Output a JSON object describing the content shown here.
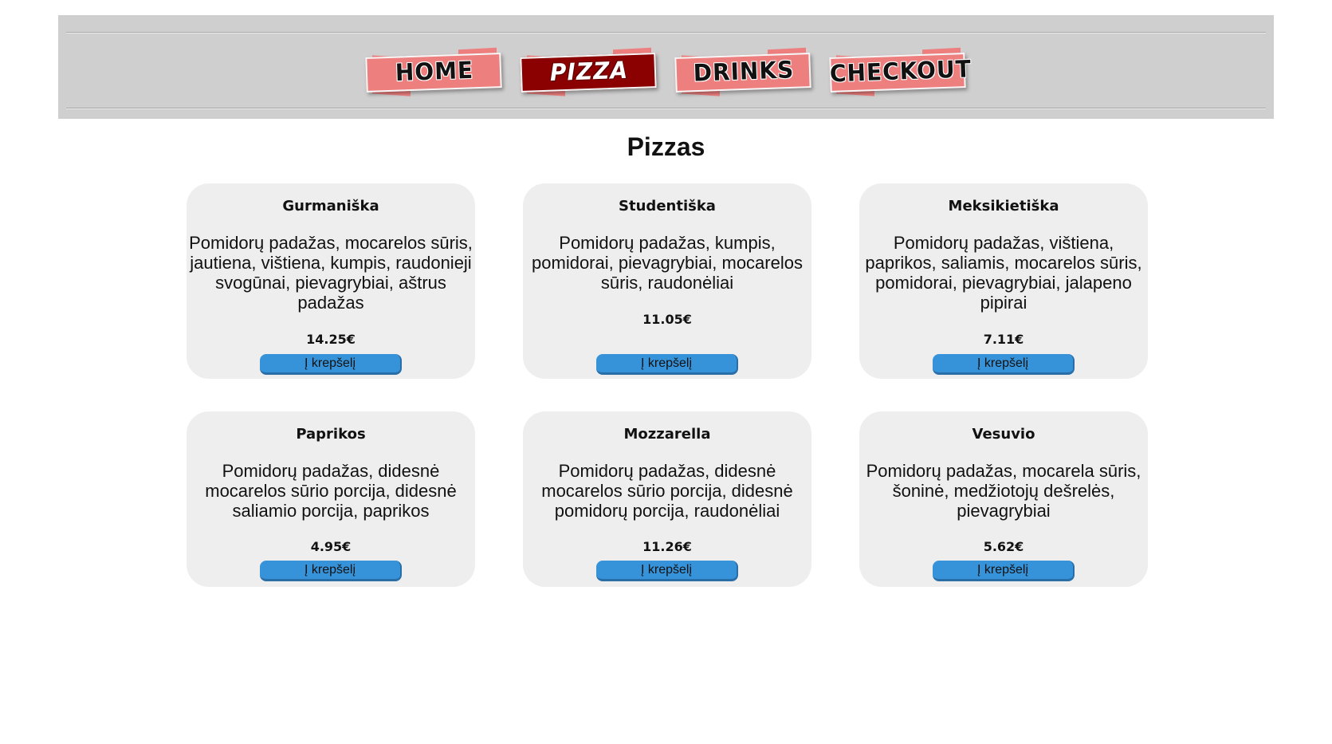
{
  "nav": {
    "items": [
      {
        "label": "HOME",
        "active": false
      },
      {
        "label": "PIZZA",
        "active": true
      },
      {
        "label": "DRINKS",
        "active": false
      },
      {
        "label": "CHECKOUT",
        "active": false
      }
    ]
  },
  "main": {
    "title": "Pizzas"
  },
  "pizzas": [
    {
      "name": "Gurmaniška",
      "description": "Pomidorų padažas, mocarelos sūris, jautiena, vištiena, kumpis, raudonieji svogūnai, pievagrybiai, aštrus padažas",
      "price": "14.25€",
      "button_label": "Į krepšelį"
    },
    {
      "name": "Studentiška",
      "description": "Pomidorų padažas, kumpis, pomidorai, pievagrybiai, mocarelos sūris, raudonėliai",
      "price": "11.05€",
      "button_label": "Į krepšelį"
    },
    {
      "name": "Meksikietiška",
      "description": "Pomidorų padažas, vištiena, paprikos, saliamis, mocarelos sūris, pomidorai, pievagrybiai, jalapeno pipirai",
      "price": "7.11€",
      "button_label": "Į krepšelį"
    },
    {
      "name": "Paprikos",
      "description": "Pomidorų padažas, didesnė mocarelos sūrio porcija, didesnė saliamio porcija, paprikos",
      "price": "4.95€",
      "button_label": "Į krepšelį"
    },
    {
      "name": "Mozzarella",
      "description": "Pomidorų padažas, didesnė mocarelos sūrio porcija, didesnė pomidorų porcija, raudonėliai",
      "price": "11.26€",
      "button_label": "Į krepšelį"
    },
    {
      "name": "Vesuvio",
      "description": "Pomidorų padažas, mocarela sūris, šoninė, medžiotojų dešrelės, pievagrybiai",
      "price": "5.62€",
      "button_label": "Į krepšelį"
    }
  ],
  "colors": {
    "header_bg": "#cfcfcf",
    "nav_item_bg": "#ee7f7f",
    "nav_active_bg": "#8b0000",
    "card_bg": "#eeeeee",
    "button_bg": "#3693d9"
  }
}
